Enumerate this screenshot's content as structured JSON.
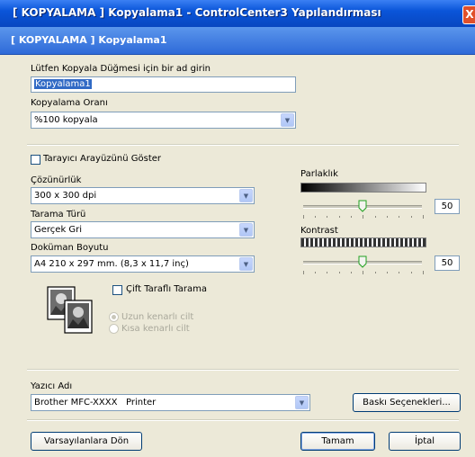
{
  "window": {
    "title": "[ KOPYALAMA ] Kopyalama1 - ControlCenter3 Yapılandırması",
    "close_glyph": "X"
  },
  "banner": {
    "title": "[ KOPYALAMA ] Kopyalama1"
  },
  "name_section": {
    "label": "Lütfen Kopyala Düğmesi için bir ad girin",
    "value": "Kopyalama1"
  },
  "ratio_section": {
    "label": "Kopyalama Oranı",
    "value": "%100 kopyala"
  },
  "scanner_ui": {
    "label": "Tarayıcı Arayüzünü Göster",
    "checked": false
  },
  "resolution": {
    "label": "Çözünürlük",
    "value": "300 x 300 dpi"
  },
  "scan_type": {
    "label": "Tarama Türü",
    "value": "Gerçek Gri"
  },
  "doc_size": {
    "label": "Doküman Boyutu",
    "value": "A4 210 x 297 mm. (8,3 x 11,7 inç)"
  },
  "brightness": {
    "label": "Parlaklık",
    "value": "50",
    "level": 0.5
  },
  "contrast": {
    "label": "Kontrast",
    "value": "50",
    "level": 0.5
  },
  "duplex": {
    "label": "Çift Taraflı Tarama",
    "checked": false,
    "options": [
      "Uzun kenarlı cilt",
      "Kısa kenarlı cilt"
    ],
    "selected_index": 0
  },
  "printer": {
    "label": "Yazıcı Adı",
    "value": "Brother MFC-XXXX   Printer",
    "options_button": "Baskı Seçenekleri..."
  },
  "footer": {
    "defaults_button": "Varsayılanlara Dön",
    "ok_button": "Tamam",
    "cancel_button": "İptal"
  },
  "colors": {
    "titlebar": "#0a55d9",
    "banner": "#2e6ad8",
    "dialog_bg": "#ece9d8",
    "close": "#e0502a"
  }
}
